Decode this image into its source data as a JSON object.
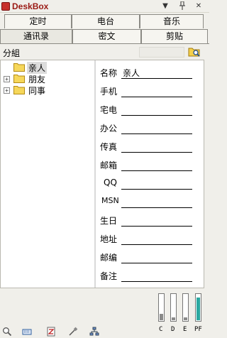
{
  "window": {
    "title": "DeskBox"
  },
  "tabs": {
    "row1": [
      "定时",
      "电台",
      "音乐"
    ],
    "row2": [
      "通讯录",
      "密文",
      "剪贴"
    ],
    "active": "通讯录"
  },
  "group_bar": {
    "label": "分組"
  },
  "tree": [
    {
      "label": "亲人",
      "expandable": false,
      "selected": true
    },
    {
      "label": "朋友",
      "expandable": true,
      "selected": false
    },
    {
      "label": "同事",
      "expandable": true,
      "selected": false
    }
  ],
  "form": [
    {
      "label": "名称",
      "value": "亲人"
    },
    {
      "label": "手机",
      "value": ""
    },
    {
      "label": "宅电",
      "value": ""
    },
    {
      "label": "办公",
      "value": ""
    },
    {
      "label": "传真",
      "value": ""
    },
    {
      "label": "邮箱",
      "value": ""
    },
    {
      "label": "QQ",
      "value": ""
    },
    {
      "label": "MSN",
      "value": ""
    },
    {
      "label": "生日",
      "value": ""
    },
    {
      "label": "地址",
      "value": ""
    },
    {
      "label": "邮编",
      "value": ""
    },
    {
      "label": "备注",
      "value": ""
    }
  ],
  "meters": [
    {
      "label": "C",
      "level": 0.25
    },
    {
      "label": "D",
      "level": 0.1
    },
    {
      "label": "E",
      "level": 0.1
    },
    {
      "label": "PF",
      "level": 0.85
    }
  ],
  "toolbar_icons": [
    "search-icon",
    "keyboard-icon",
    "document-icon",
    "pipette-icon",
    "network-icon"
  ],
  "colors": {
    "title": "#9a1a14",
    "pf_meter": "#2aa8a0"
  }
}
